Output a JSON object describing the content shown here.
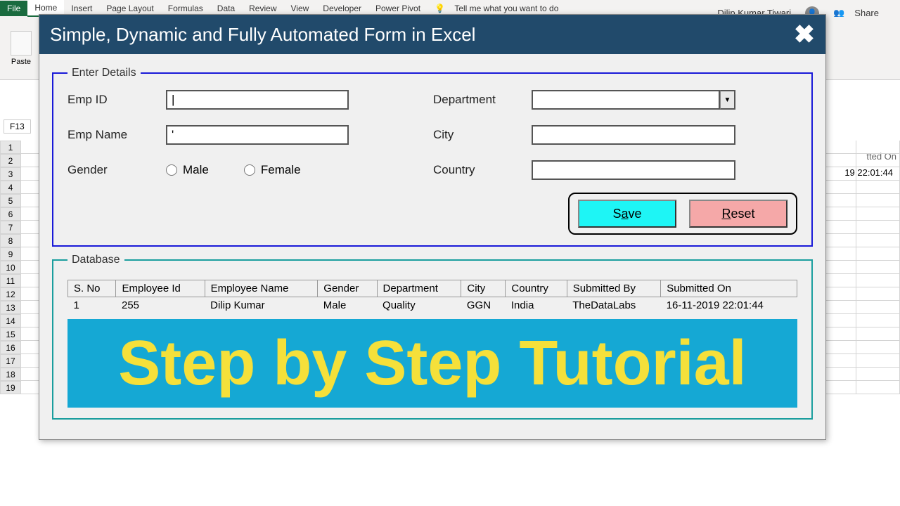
{
  "ribbon": {
    "tabs": [
      "File",
      "Home",
      "Insert",
      "Page Layout",
      "Formulas",
      "Data",
      "Review",
      "View",
      "Developer",
      "Power Pivot"
    ],
    "tell_me": "Tell me what you want to do",
    "paste": "Paste",
    "user": "Dilip Kumar Tiwari",
    "share": "Share"
  },
  "cell_ref": "F13",
  "bg_col_hint": "tted On",
  "bg_cell": "19 22:01:44",
  "dialog": {
    "title": "Simple, Dynamic and Fully Automated Form in Excel",
    "enter_legend": "Enter Details",
    "labels": {
      "emp_id": "Emp ID",
      "emp_name": "Emp Name",
      "gender": "Gender",
      "department": "Department",
      "city": "City",
      "country": "Country"
    },
    "values": {
      "emp_id": "|",
      "emp_name": "'",
      "department": "",
      "city": "",
      "country": ""
    },
    "radio": {
      "male": "Male",
      "female": "Female"
    },
    "buttons": {
      "save_pre": "S",
      "save_u": "a",
      "save_post": "ve",
      "reset_pre": "",
      "reset_u": "R",
      "reset_post": "eset"
    },
    "db_legend": "Database",
    "headers": [
      "S. No",
      "Employee Id",
      "Employee Name",
      "Gender",
      "Department",
      "City",
      "Country",
      "Submitted By",
      "Submitted On"
    ],
    "rows": [
      [
        "1",
        "255",
        "Dilip Kumar",
        "Male",
        "Quality",
        "GGN",
        "India",
        "TheDataLabs",
        "16-11-2019 22:01:44"
      ]
    ],
    "tutorial": "Step by Step Tutorial"
  }
}
